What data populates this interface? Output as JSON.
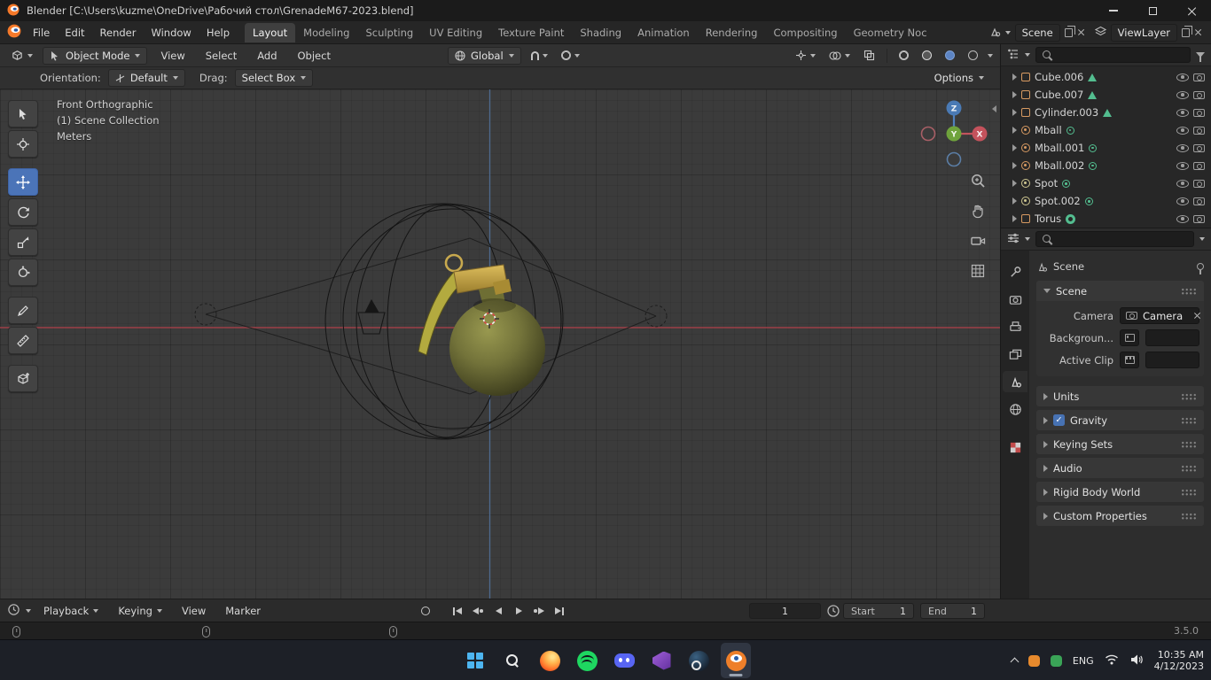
{
  "icons": {
    "caret_down": "▾",
    "disclosure": "▸",
    "check": "✓"
  },
  "titlebar": {
    "app_title": "Blender [C:\\Users\\kuzme\\OneDrive\\Рабочий стол\\GrenadeM67-2023.blend]"
  },
  "topbar": {
    "menus": [
      {
        "label": "File"
      },
      {
        "label": "Edit"
      },
      {
        "label": "Render"
      },
      {
        "label": "Window"
      },
      {
        "label": "Help"
      }
    ],
    "workspaces": [
      {
        "label": "Layout"
      },
      {
        "label": "Modeling"
      },
      {
        "label": "Sculpting"
      },
      {
        "label": "UV Editing"
      },
      {
        "label": "Texture Paint"
      },
      {
        "label": "Shading"
      },
      {
        "label": "Animation"
      },
      {
        "label": "Rendering"
      },
      {
        "label": "Compositing"
      },
      {
        "label": "Geometry Noc"
      }
    ],
    "active_workspace": "Layout",
    "scene_selector": {
      "value": "Scene"
    },
    "viewlayer_selector": {
      "value": "ViewLayer"
    }
  },
  "tool_header": {
    "mode": "Object Mode",
    "menus": [
      {
        "label": "View"
      },
      {
        "label": "Select"
      },
      {
        "label": "Add"
      },
      {
        "label": "Object"
      }
    ],
    "orientation": "Global"
  },
  "tool_settings": {
    "orientation_label": "Orientation:",
    "orientation_value": "Default",
    "drag_label": "Drag:",
    "drag_value": "Select Box",
    "options": "Options"
  },
  "viewport": {
    "view_name": "Front Orthographic",
    "collection": "(1) Scene Collection",
    "units": "Meters",
    "axis_labels": {
      "x": "X",
      "y": "Y",
      "z": "Z"
    }
  },
  "outliner": {
    "items": [
      {
        "name": "Cube.006"
      },
      {
        "name": "Cube.007"
      },
      {
        "name": "Cylinder.003"
      },
      {
        "name": "Mball"
      },
      {
        "name": "Mball.001"
      },
      {
        "name": "Mball.002"
      },
      {
        "name": "Spot"
      },
      {
        "name": "Spot.002"
      },
      {
        "name": "Torus"
      }
    ]
  },
  "properties": {
    "breadcrumb": "Scene",
    "scene_panel": {
      "title": "Scene",
      "camera_label": "Camera",
      "camera_value": "Camera",
      "background_label": "Backgroun...",
      "active_clip_label": "Active Clip"
    },
    "collapsed_panels": [
      {
        "title": "Units"
      },
      {
        "title": "Gravity"
      },
      {
        "title": "Keying Sets"
      },
      {
        "title": "Audio"
      },
      {
        "title": "Rigid Body World"
      },
      {
        "title": "Custom Properties"
      }
    ]
  },
  "timeline": {
    "menus": [
      {
        "label": "Playback"
      },
      {
        "label": "Keying"
      },
      {
        "label": "View"
      },
      {
        "label": "Marker"
      }
    ],
    "current_frame": "1",
    "start_label": "Start",
    "start_value": "1",
    "end_label": "End",
    "end_value": "1"
  },
  "statusbar": {
    "version": "3.5.0"
  },
  "taskbar": {
    "tray": {
      "language": "ENG",
      "time": "10:35 AM",
      "date": "4/12/2023"
    }
  }
}
